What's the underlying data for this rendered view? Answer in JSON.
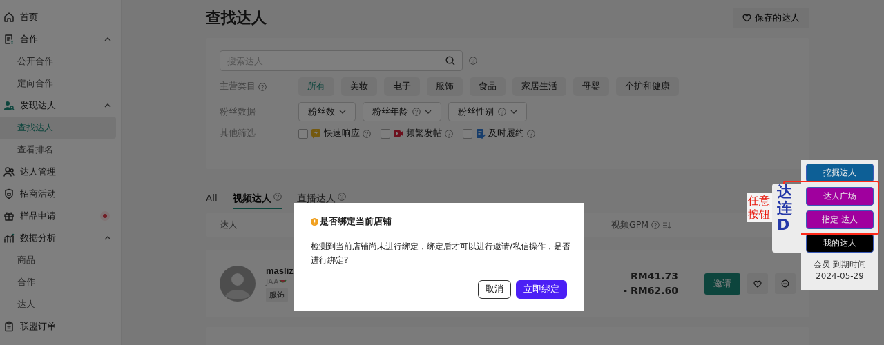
{
  "sidebar": {
    "items": [
      {
        "label": "首页"
      },
      {
        "label": "合作",
        "expanded": true,
        "children": [
          {
            "label": "公开合作",
            "selected": false
          },
          {
            "label": "定向合作",
            "selected": false
          }
        ]
      },
      {
        "label": "发现达人",
        "expanded": true,
        "children": [
          {
            "label": "查找达人",
            "selected": true
          },
          {
            "label": "查看排名",
            "selected": false
          }
        ]
      },
      {
        "label": "达人管理"
      },
      {
        "label": "招商活动"
      },
      {
        "label": "样品申请",
        "badge": true
      },
      {
        "label": "数据分析",
        "expanded": true,
        "children": [
          {
            "label": "商品",
            "selected": false
          },
          {
            "label": "合作",
            "selected": false
          },
          {
            "label": "达人",
            "selected": false
          }
        ]
      },
      {
        "label": "联盟订单"
      }
    ]
  },
  "page": {
    "title": "查找达人",
    "saved_button": "保存的达人"
  },
  "search": {
    "placeholder": "搜索达人"
  },
  "filters": {
    "category": {
      "label": "主营类目",
      "chips": [
        {
          "label": "所有",
          "selected": true
        },
        {
          "label": "美妆",
          "selected": false
        },
        {
          "label": "电子",
          "selected": false
        },
        {
          "label": "服饰",
          "selected": false
        },
        {
          "label": "食品",
          "selected": false
        },
        {
          "label": "家居生活",
          "selected": false
        },
        {
          "label": "母婴",
          "selected": false
        },
        {
          "label": "个护和健康",
          "selected": false
        }
      ]
    },
    "fans": {
      "label": "粉丝数据",
      "dropdowns": [
        {
          "label": "粉丝数",
          "help": false
        },
        {
          "label": "粉丝年龄",
          "help": true
        },
        {
          "label": "粉丝性别",
          "help": true
        }
      ]
    },
    "other": {
      "label": "其他筛选",
      "checkboxes": [
        {
          "label": "快速响应",
          "checked": false
        },
        {
          "label": "频繁发帖",
          "checked": false
        },
        {
          "label": "及时履约",
          "checked": false
        }
      ]
    }
  },
  "tabs": [
    {
      "label": "All",
      "selected": false,
      "help": false
    },
    {
      "label": "视频达人",
      "selected": true,
      "help": true
    },
    {
      "label": "直播达人",
      "selected": false,
      "help": true
    }
  ],
  "table": {
    "columns": [
      "达人",
      "视频GPM"
    ],
    "rows": [
      {
        "name": "masliz",
        "handle": "JAA",
        "tag": "服饰",
        "gpm_low": "RM41.73",
        "gpm_high": "- RM62.60",
        "invite": "邀请"
      }
    ]
  },
  "dialog": {
    "title": "是否绑定当前店铺",
    "message": "检测到当前店铺尚未进行绑定，绑定后才可以进行邀请/私信操作，是否进行绑定?",
    "buttons": [
      {
        "label": "取消",
        "kind": "secondary"
      },
      {
        "label": "立即绑定",
        "kind": "primary"
      }
    ]
  },
  "widget": {
    "logo": "达连D",
    "buttons": [
      {
        "label": "挖掘达人",
        "color": "#0d5f96"
      },
      {
        "label": "达人广场",
        "color": "#a0009e"
      },
      {
        "label": "指定 达人",
        "color": "#a0009e"
      },
      {
        "label": "我的达人",
        "color": "#000000"
      }
    ],
    "member_label": "会员 到期时间",
    "member_date": "2024-05-29"
  },
  "annotation": {
    "text": "任意按钮"
  }
}
